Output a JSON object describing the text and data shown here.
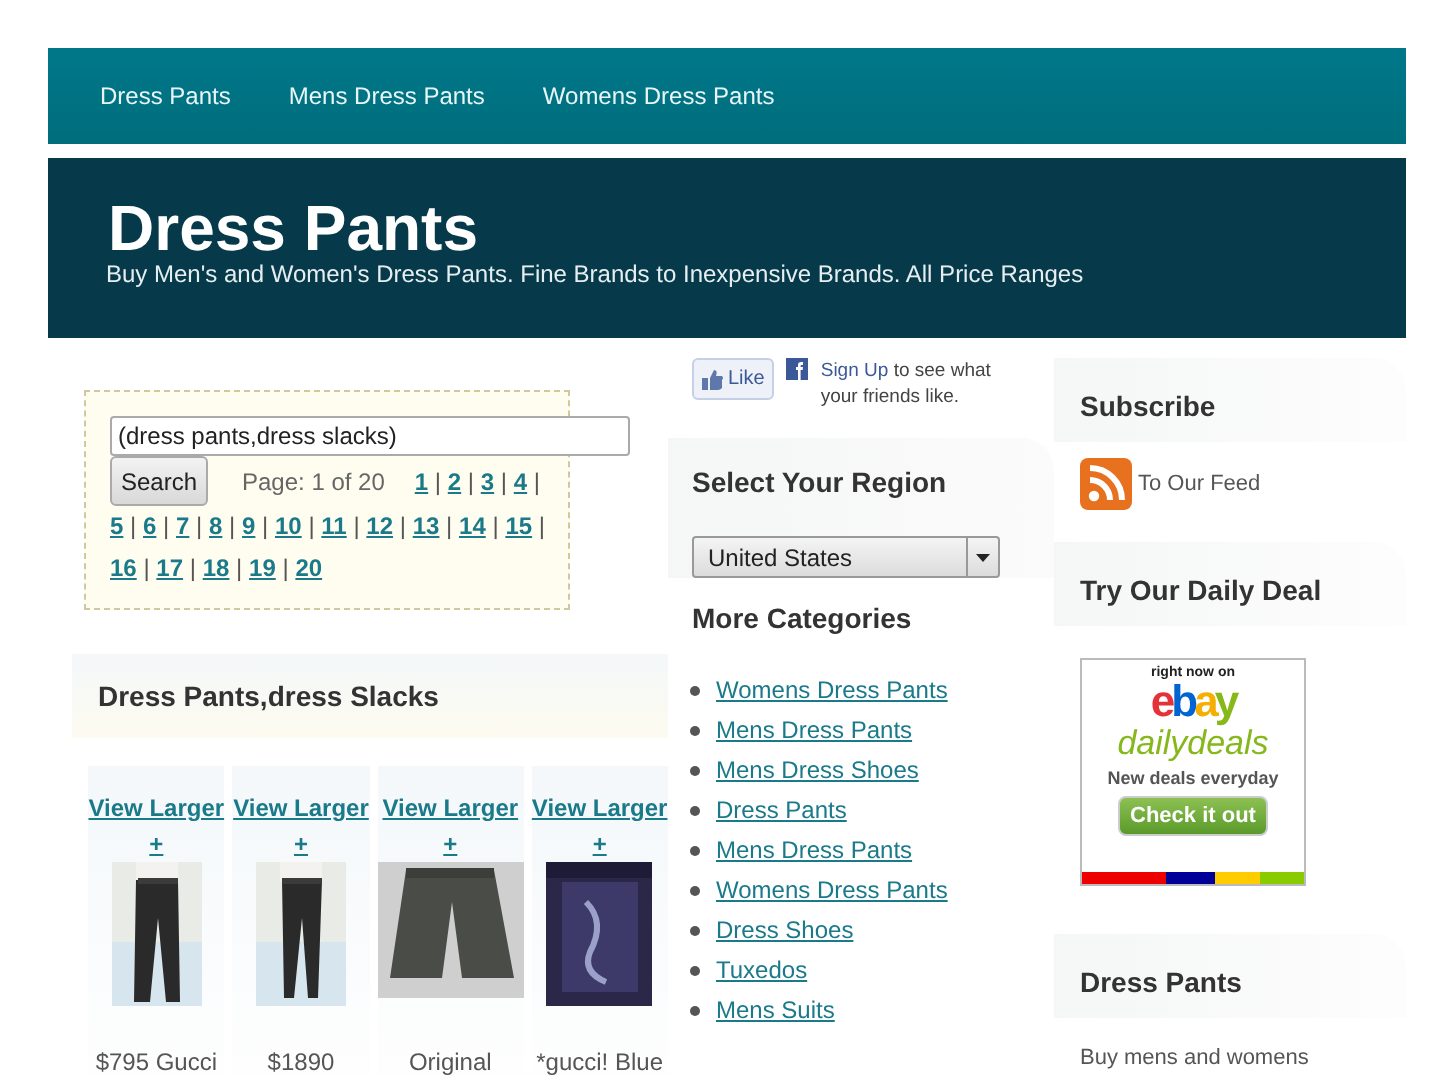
{
  "nav": [
    "Dress Pants",
    "Mens Dress Pants",
    "Womens Dress Pants"
  ],
  "header": {
    "title": "Dress Pants",
    "tagline": "Buy Men's and Women's Dress Pants. Fine Brands to Inexpensive Brands. All Price Ranges"
  },
  "search": {
    "value": "(dress pants,dress slacks)",
    "button": "Search",
    "page_label": "Page: 1 of 20",
    "separator": "|",
    "pages": [
      "1",
      "2",
      "3",
      "4",
      "5",
      "6",
      "7",
      "8",
      "9",
      "10",
      "11",
      "12",
      "13",
      "14",
      "15",
      "16",
      "17",
      "18",
      "19",
      "20"
    ]
  },
  "content": {
    "heading": "Dress Pants,dress Slacks",
    "products": [
      {
        "link": "View Larger",
        "plus": "+",
        "price": "$795 Gucci"
      },
      {
        "link": "View Larger",
        "plus": "+",
        "price": "$1890"
      },
      {
        "link": "View Larger",
        "plus": "+",
        "price": "Original"
      },
      {
        "link": "View Larger",
        "plus": "+",
        "price": "*gucci! Blue"
      }
    ]
  },
  "facebook": {
    "like": "Like",
    "signup": "Sign Up",
    "signup_text": "to see what your friends like."
  },
  "region": {
    "heading": "Select Your Region",
    "value": "United States"
  },
  "categories": {
    "heading": "More Categories",
    "items": [
      "Womens Dress Pants",
      "Mens Dress Pants",
      "Mens Dress Shoes",
      "Dress Pants",
      "Mens Dress Pants",
      "Womens Dress Pants",
      "Dress Shoes",
      "Tuxedos",
      "Mens Suits"
    ]
  },
  "subscribe": {
    "heading": "Subscribe",
    "feed": "To Our Feed"
  },
  "deal": {
    "heading": "Try Our Daily Deal",
    "ad": {
      "top": "right now on",
      "logo": "ebay",
      "brand": "dailydeals",
      "tagline": "New deals everyday",
      "button": "Check it out"
    }
  },
  "about": {
    "heading": "Dress Pants",
    "text": "Buy mens and womens"
  }
}
